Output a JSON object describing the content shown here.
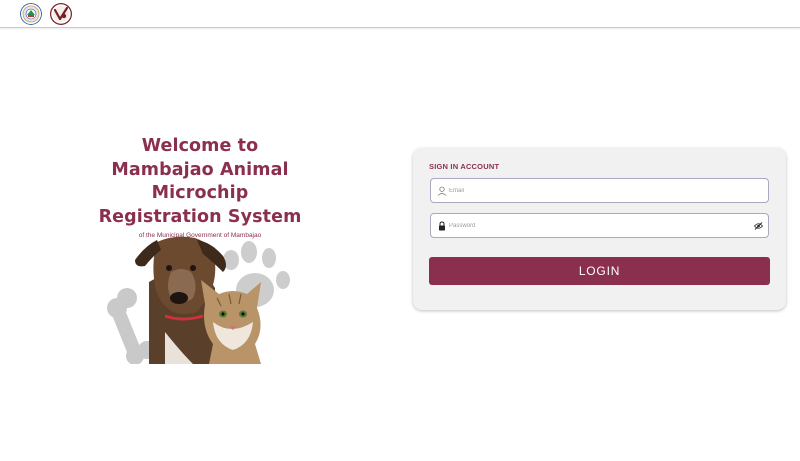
{
  "hero": {
    "line1": "Welcome to",
    "line2": "Mambajao Animal Microchip",
    "line3": "Registration System",
    "subtitle": "of the Municipal Government of Mambajao"
  },
  "login_form": {
    "heading": "SIGN IN ACCOUNT",
    "email_placeholder": "Email",
    "email_value": "",
    "password_placeholder": "Password",
    "password_value": "",
    "submit_label": "LOGIN"
  },
  "icons": {
    "email": "user-icon",
    "password": "lock-icon",
    "toggle_password": "eye-slash-icon"
  },
  "colors": {
    "brand": "#8b2f4e",
    "card_bg": "#f1f1f1",
    "field_border": "#a9a9c0"
  }
}
